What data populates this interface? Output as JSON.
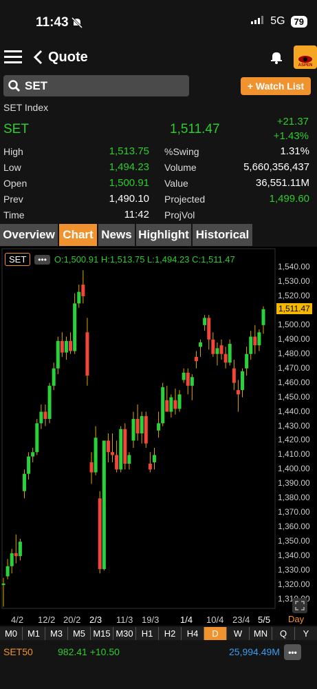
{
  "status": {
    "time": "11:43",
    "network": "5G",
    "battery": "79"
  },
  "nav": {
    "title": "Quote",
    "logo": "ASPEN"
  },
  "search": {
    "value": "SET"
  },
  "watch_button": "+ Watch List",
  "quote": {
    "name": "SET Index",
    "symbol": "SET",
    "last": "1,511.47",
    "change": "+21.37",
    "change_pct": "+1.43%",
    "left_rows": [
      {
        "label": "High",
        "value": "1,513.75"
      },
      {
        "label": "Low",
        "value": "1,494.23"
      },
      {
        "label": "Open",
        "value": "1,500.91"
      },
      {
        "label": "Prev",
        "value": "1,490.10"
      },
      {
        "label": "Time",
        "value": "11:42"
      }
    ],
    "right_rows": [
      {
        "label": "%Swing",
        "value": "1.31%"
      },
      {
        "label": "Volume",
        "value": "5,660,356,437"
      },
      {
        "label": "Value",
        "value": "36,551.11M"
      },
      {
        "label": "Projected",
        "value": "1,499.60"
      },
      {
        "label": "ProjVol",
        "value": ""
      }
    ]
  },
  "tabs": [
    "Overview",
    "Chart",
    "News",
    "Highlight",
    "Historical"
  ],
  "chart_header": {
    "symbol": "SET",
    "ohlc": "O:1,500.91 H:1,513.75 L:1,494.23 C:1,511.47"
  },
  "chart_data": {
    "type": "candlestick",
    "y_ticks": [
      "1,540.00",
      "1,530.00",
      "1,520.00",
      "1,510.00",
      "1,500.00",
      "1,490.00",
      "1,480.00",
      "1,470.00",
      "1,460.00",
      "1,450.00",
      "1,440.00",
      "1,430.00",
      "1,420.00",
      "1,410.00",
      "1,400.00",
      "1,390.00",
      "1,380.00",
      "1,370.00",
      "1,360.00",
      "1,350.00",
      "1,340.00",
      "1,330.00",
      "1,320.00",
      "1,310.00"
    ],
    "x_ticks": [
      "4/2",
      "12/2",
      "20/2",
      "2/3",
      "11/3",
      "19/3",
      "1/4",
      "10/4",
      "23/4",
      "5/5"
    ],
    "last_price_label": "1,511.47",
    "ylim": [
      1310,
      1545
    ],
    "candles": [
      [
        1320,
        1325,
        1305,
        1321
      ],
      [
        1326,
        1338,
        1324,
        1333
      ],
      [
        1333,
        1345,
        1328,
        1342
      ],
      [
        1342,
        1355,
        1335,
        1340
      ],
      [
        1340,
        1352,
        1337,
        1350
      ],
      [
        1385,
        1400,
        1380,
        1397
      ],
      [
        1397,
        1412,
        1393,
        1409
      ],
      [
        1409,
        1415,
        1405,
        1412
      ],
      [
        1412,
        1435,
        1410,
        1432
      ],
      [
        1432,
        1445,
        1428,
        1440
      ],
      [
        1440,
        1445,
        1430,
        1435
      ],
      [
        1435,
        1460,
        1432,
        1458
      ],
      [
        1458,
        1474,
        1455,
        1470
      ],
      [
        1470,
        1492,
        1466,
        1489
      ],
      [
        1489,
        1495,
        1478,
        1481
      ],
      [
        1481,
        1492,
        1476,
        1489
      ],
      [
        1489,
        1495,
        1480,
        1482
      ],
      [
        1482,
        1522,
        1480,
        1515
      ],
      [
        1515,
        1528,
        1512,
        1523
      ],
      [
        1528,
        1538,
        1515,
        1520
      ],
      [
        1495,
        1505,
        1458,
        1465
      ],
      [
        1405,
        1412,
        1390,
        1398
      ],
      [
        1398,
        1430,
        1396,
        1422
      ],
      [
        1380,
        1385,
        1328,
        1331
      ],
      [
        1331,
        1420,
        1330,
        1420
      ],
      [
        1420,
        1425,
        1405,
        1412
      ],
      [
        1412,
        1425,
        1405,
        1410
      ],
      [
        1410,
        1420,
        1398,
        1400
      ],
      [
        1400,
        1430,
        1398,
        1428
      ],
      [
        1428,
        1432,
        1400,
        1404
      ],
      [
        1404,
        1412,
        1400,
        1410
      ],
      [
        1420,
        1440,
        1415,
        1435
      ],
      [
        1435,
        1445,
        1420,
        1425
      ],
      [
        1425,
        1440,
        1418,
        1437
      ],
      [
        1437,
        1440,
        1415,
        1418
      ],
      [
        1404,
        1412,
        1398,
        1400
      ],
      [
        1405,
        1415,
        1400,
        1410
      ],
      [
        1427,
        1440,
        1422,
        1432
      ],
      [
        1432,
        1460,
        1430,
        1457
      ],
      [
        1448,
        1458,
        1440,
        1440
      ],
      [
        1440,
        1452,
        1436,
        1450
      ],
      [
        1448,
        1456,
        1438,
        1442
      ],
      [
        1442,
        1455,
        1440,
        1452
      ],
      [
        1462,
        1470,
        1460,
        1467
      ],
      [
        1467,
        1470,
        1452,
        1458
      ],
      [
        1458,
        1466,
        1448,
        1464
      ],
      [
        1478,
        1482,
        1470,
        1475
      ],
      [
        1485,
        1490,
        1478,
        1488
      ],
      [
        1500,
        1507,
        1496,
        1505
      ],
      [
        1505,
        1507,
        1483,
        1490
      ],
      [
        1490,
        1495,
        1478,
        1480
      ],
      [
        1480,
        1488,
        1472,
        1484
      ],
      [
        1486,
        1490,
        1476,
        1480
      ],
      [
        1480,
        1485,
        1470,
        1474
      ],
      [
        1474,
        1490,
        1472,
        1487
      ],
      [
        1470,
        1476,
        1455,
        1460
      ],
      [
        1455,
        1462,
        1440,
        1452
      ],
      [
        1455,
        1470,
        1450,
        1468
      ],
      [
        1470,
        1485,
        1465,
        1480
      ],
      [
        1480,
        1496,
        1476,
        1492
      ],
      [
        1492,
        1500,
        1480,
        1486
      ],
      [
        1486,
        1497,
        1482,
        1495
      ],
      [
        1500,
        1513,
        1494,
        1511
      ]
    ]
  },
  "timeframes": [
    "M0",
    "M1",
    "M3",
    "M5",
    "M15",
    "M30",
    "H1",
    "H2",
    "H4",
    "D",
    "W",
    "MN",
    "Q",
    "Y"
  ],
  "active_timeframe": "D",
  "period_label": "Day",
  "footer": {
    "symbol": "SET50",
    "price": "982.41 +10.50",
    "value": "25,994.49M"
  },
  "icons": [
    "menu-icon",
    "back-chevron-icon",
    "bell-icon",
    "search-icon",
    "expand-icon",
    "more-icon"
  ]
}
